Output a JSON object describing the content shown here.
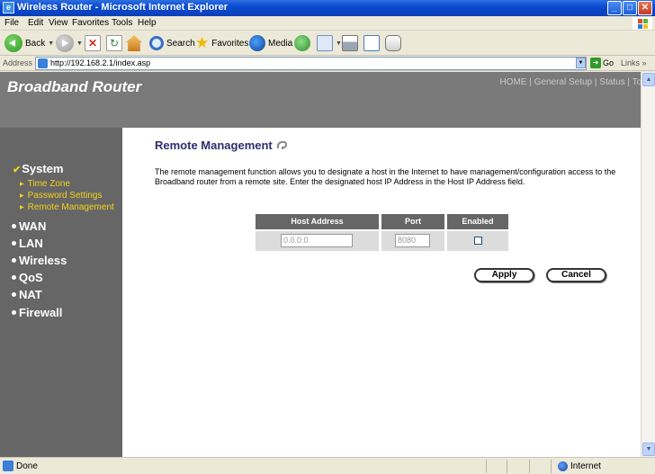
{
  "window": {
    "title": "Wireless Router - Microsoft Internet Explorer",
    "min": "_",
    "max": "□",
    "close": "✕"
  },
  "menu": [
    "File",
    "Edit",
    "View",
    "Favorites",
    "Tools",
    "Help"
  ],
  "toolbar": {
    "back": "Back",
    "search": "Search",
    "favorites": "Favorites",
    "media": "Media"
  },
  "address": {
    "label": "Address",
    "url": "http://192.168.2.1/index.asp",
    "go": "Go",
    "links": "Links »"
  },
  "page": {
    "brand": "Broadband Router",
    "topnav": [
      "HOME",
      "General Setup",
      "Status",
      "Tools"
    ],
    "sidebar": {
      "system": "System",
      "system_subitems": [
        "Time Zone",
        "Password Settings",
        "Remote Management"
      ],
      "items": [
        "WAN",
        "LAN",
        "Wireless",
        "QoS",
        "NAT",
        "Firewall"
      ]
    },
    "title": "Remote Management",
    "description": "The remote management function allows you to designate a host in the Internet to have management/configuration access to the Broadband router from a remote site. Enter the designated host IP Address in the Host IP Address field.",
    "table": {
      "headers": [
        "Host Address",
        "Port",
        "Enabled"
      ],
      "host_address": "0.0.0.0",
      "port": "8080",
      "enabled": false
    },
    "apply": "Apply",
    "cancel": "Cancel"
  },
  "status": {
    "text": "Done",
    "zone": "Internet"
  }
}
